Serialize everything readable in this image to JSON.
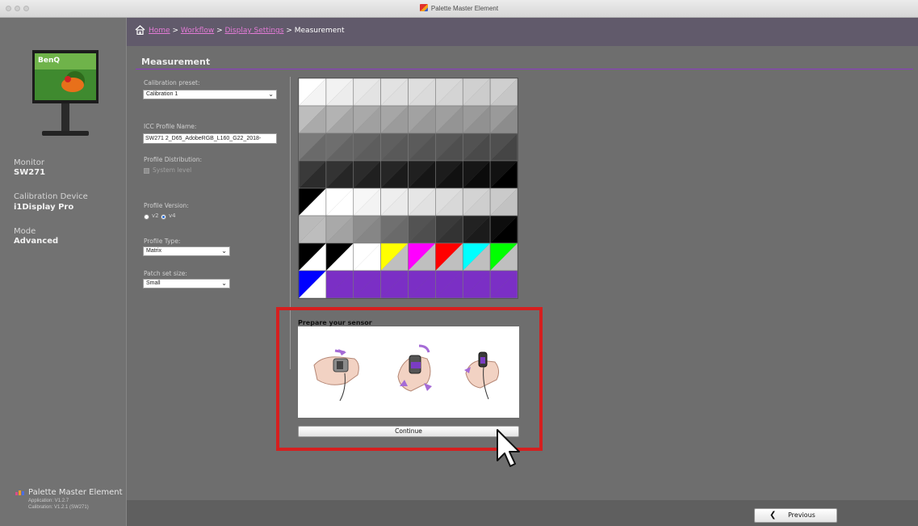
{
  "window": {
    "title": "Palette Master Element"
  },
  "breadcrumb": {
    "home": "Home",
    "workflow": "Workflow",
    "display_settings": "Display Settings",
    "current": "Measurement",
    "sep": ">"
  },
  "sidebar": {
    "monitor_label": "Monitor",
    "monitor_value": "SW271",
    "device_label": "Calibration Device",
    "device_value": "i1Display Pro",
    "mode_label": "Mode",
    "mode_value": "Advanced",
    "brand_name": "Palette Master Element",
    "app_version": "Application: V1.2.7",
    "cal_version": "Calibration: V1.2.1 (SW271)"
  },
  "page": {
    "title": "Measurement"
  },
  "form": {
    "preset_label": "Calibration preset:",
    "preset_value": "Calibration 1",
    "icc_label": "ICC Profile Name:",
    "icc_value": "SW271 2_D65_AdobeRGB_L160_G22_2018-",
    "distribution_label": "Profile Distribution:",
    "system_level_label": "System level",
    "version_label": "Profile Version:",
    "v2_label": "v2",
    "v4_label": "v4",
    "type_label": "Profile Type:",
    "type_value": "Matrix",
    "patch_label": "Patch set size:",
    "patch_value": "Small"
  },
  "sensor": {
    "title": "Prepare your sensor",
    "continue_label": "Continue"
  },
  "footer": {
    "previous_label": "Previous"
  },
  "patches": [
    [
      "#ffffff",
      "#f2f2f2",
      "#e8e8e8",
      "#e2e2e2",
      "#dedede",
      "#d8d8d8",
      "#d0d0d0",
      "#cfcfcf"
    ],
    [
      "#bdbdbd",
      "#b3b3b3",
      "#a9a9a9",
      "#a6a6a6",
      "#a2a2a2",
      "#9f9f9f",
      "#9b9b9b",
      "#9a9a9a"
    ],
    [
      "#7a7a7a",
      "#6e6e6e",
      "#636363",
      "#5f5f5f",
      "#5b5b5b",
      "#575757",
      "#525252",
      "#4f4f4f"
    ],
    [
      "#3a3a3a",
      "#333333",
      "#2b2b2b",
      "#262626",
      "#202020",
      "#1c1c1c",
      "#161616",
      "#111111"
    ],
    [
      "#000000",
      "#ffffff",
      "#f7f7f7",
      "#eeeeee",
      "#e6e6e6",
      "#dddddd",
      "#d3d3d3",
      "#cacaca"
    ],
    [
      "#bababa",
      "#a9a9a9",
      "#8d8d8d",
      "#707070",
      "#535353",
      "#3a3a3a",
      "#222222",
      "#0d0d0d"
    ],
    [
      "#000000",
      "#000000",
      "#ffffff",
      "#ffff00",
      "#ff00ff",
      "#ff0000",
      "#00ffff",
      "#00ff00"
    ],
    [
      "#0000ff",
      "#7b2fc5",
      "#7b2fc5",
      "#7b2fc5",
      "#7b2fc5",
      "#7b2fc5",
      "#7b2fc5",
      "#7b2fc5"
    ]
  ],
  "patches_lower": [
    [
      "#f4f4f4",
      "#ececec",
      "#e3e3e3",
      "#dfdfdf",
      "#dadada",
      "#d4d4d4",
      "#cccccc",
      "#c6c6c6"
    ],
    [
      "#aaaaaa",
      "#a4a4a4",
      "#a0a0a0",
      "#9b9b9b",
      "#989898",
      "#949494",
      "#919191",
      "#8c8c8c"
    ],
    [
      "#6a6a6a",
      "#646464",
      "#5d5d5d",
      "#595959",
      "#545454",
      "#4f4f4f",
      "#4a4a4a",
      "#454545"
    ],
    [
      "#2c2c2c",
      "#262626",
      "#202020",
      "#1b1b1b",
      "#161616",
      "#111111",
      "#0b0b0b",
      "#000000"
    ],
    [
      "#ffffff",
      "#ffffff",
      "#f3f3f3",
      "#eaeaea",
      "#e1e1e1",
      "#d8d8d8",
      "#cecece",
      "#c2c2c2"
    ],
    [
      "#bdbdbd",
      "#a2a2a2",
      "#868686",
      "#6a6a6a",
      "#4e4e4e",
      "#333333",
      "#1b1b1b",
      "#000000"
    ],
    [
      "#ffffff",
      "#ffffff",
      "#ffffff",
      "#bfbfbf",
      "#bfbfbf",
      "#bfbfbf",
      "#bfbfbf",
      "#bfbfbf"
    ],
    [
      "#ffffff",
      "#7b2fc5",
      "#7b2fc5",
      "#7b2fc5",
      "#7b2fc5",
      "#7b2fc5",
      "#7b2fc5",
      "#7b2fc5"
    ]
  ]
}
